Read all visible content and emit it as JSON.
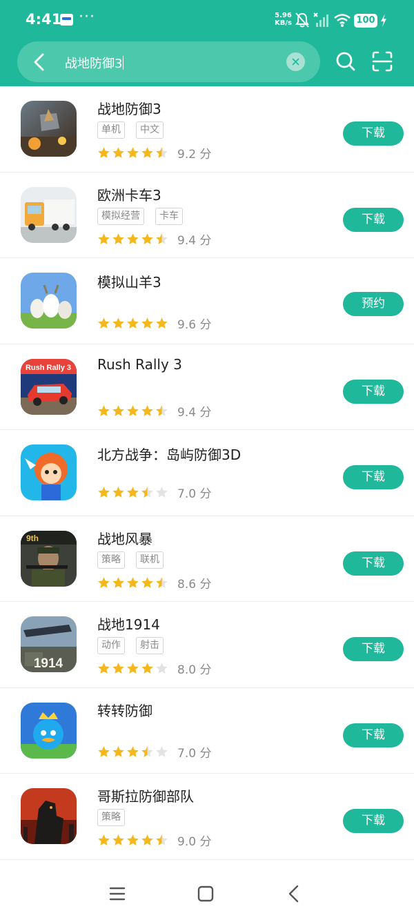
{
  "status_bar": {
    "time": "4:41",
    "more": "···",
    "net_speed_value": "5.96",
    "net_speed_unit": "KB/s",
    "battery": "100",
    "icons": [
      "notification-card-icon",
      "mute-icon",
      "signal-icon",
      "wifi-icon",
      "battery-icon",
      "charging-icon"
    ]
  },
  "search": {
    "query": "战地防御3"
  },
  "colors": {
    "brand": "#1fb89a",
    "star": "#f5b81c",
    "star_empty": "#e3e3e3"
  },
  "results": [
    {
      "name": "战地防御3",
      "tags": [
        "单机",
        "中文"
      ],
      "stars": 4.5,
      "score": "9.2 分",
      "action": "下载",
      "icon": "war-defense-3-icon"
    },
    {
      "name": "欧洲卡车3",
      "tags": [
        "模拟经营",
        "卡车"
      ],
      "stars": 4.5,
      "score": "9.4 分",
      "action": "下载",
      "icon": "euro-truck-3-icon"
    },
    {
      "name": "模拟山羊3",
      "tags": [],
      "stars": 5,
      "score": "9.6 分",
      "action": "预约",
      "icon": "goat-simulator-3-icon"
    },
    {
      "name": "Rush Rally 3",
      "tags": [],
      "stars": 4.5,
      "score": "9.4 分",
      "action": "下载",
      "icon": "rush-rally-3-icon"
    },
    {
      "name": "北方战争：岛屿防御3D",
      "tags": [],
      "stars": 3.5,
      "score": "7.0 分",
      "action": "下载",
      "icon": "northern-war-icon"
    },
    {
      "name": "战地风暴",
      "tags": [
        "策略",
        "联机"
      ],
      "stars": 4.5,
      "score": "8.6 分",
      "action": "下载",
      "icon": "battlefield-storm-icon"
    },
    {
      "name": "战地1914",
      "tags": [
        "动作",
        "射击"
      ],
      "stars": 4,
      "score": "8.0 分",
      "action": "下载",
      "icon": "battlefield-1914-icon"
    },
    {
      "name": "转转防御",
      "tags": [],
      "stars": 3.5,
      "score": "7.0 分",
      "action": "下载",
      "icon": "spin-defense-icon"
    },
    {
      "name": "哥斯拉防御部队",
      "tags": [
        "策略"
      ],
      "stars": 4.5,
      "score": "9.0 分",
      "action": "下载",
      "icon": "godzilla-defense-icon"
    }
  ]
}
